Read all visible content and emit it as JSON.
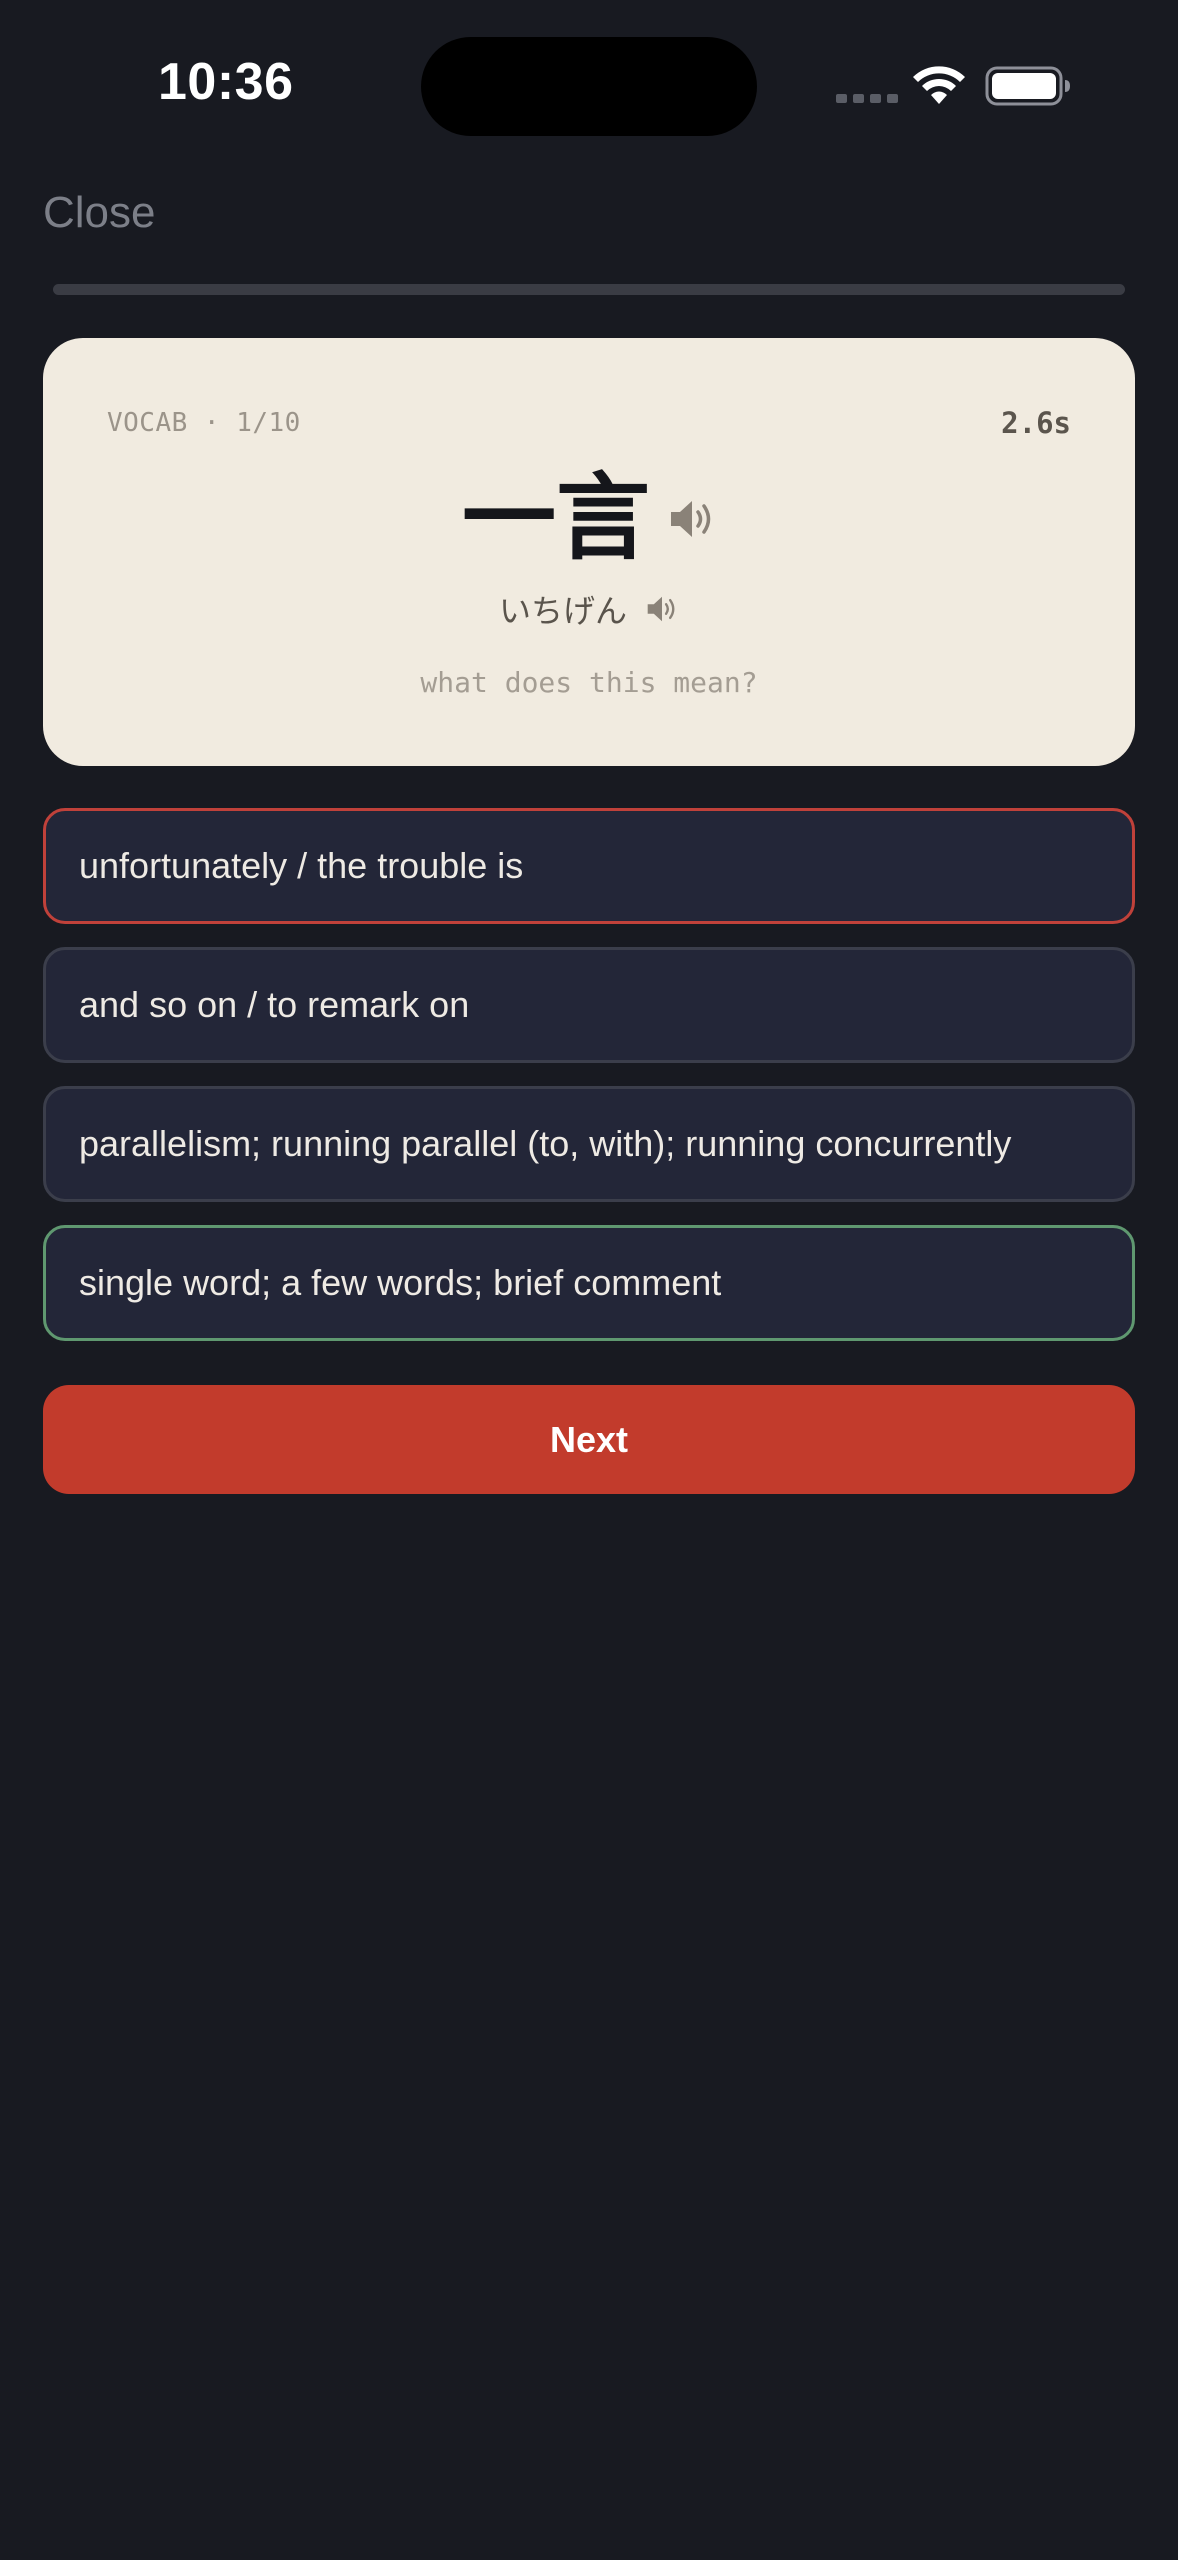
{
  "status_bar": {
    "time": "10:36",
    "wifi_icon": "wifi-icon",
    "battery_icon": "battery-icon"
  },
  "header": {
    "close_label": "Close",
    "progress_fraction": 0.0
  },
  "card": {
    "meta": "VOCAB · 1/10",
    "timer": "2.6s",
    "word": "一言",
    "reading": "いちげん",
    "prompt": "what does this mean?",
    "speaker_icon": "speaker-icon"
  },
  "options": [
    {
      "label": "unfortunately / the trouble is",
      "state": "wrong"
    },
    {
      "label": "and so on / to remark on",
      "state": "neutral"
    },
    {
      "label": "parallelism; running parallel (to, with); running concurrently",
      "state": "neutral"
    },
    {
      "label": "single word; a few words; brief comment",
      "state": "correct"
    }
  ],
  "actions": {
    "next_label": "Next"
  },
  "colors": {
    "background": "#181a21",
    "card": "#f1ebe0",
    "accent": "#c23b2c",
    "wrong_border": "#c0413a",
    "correct_border": "#5f9870"
  }
}
